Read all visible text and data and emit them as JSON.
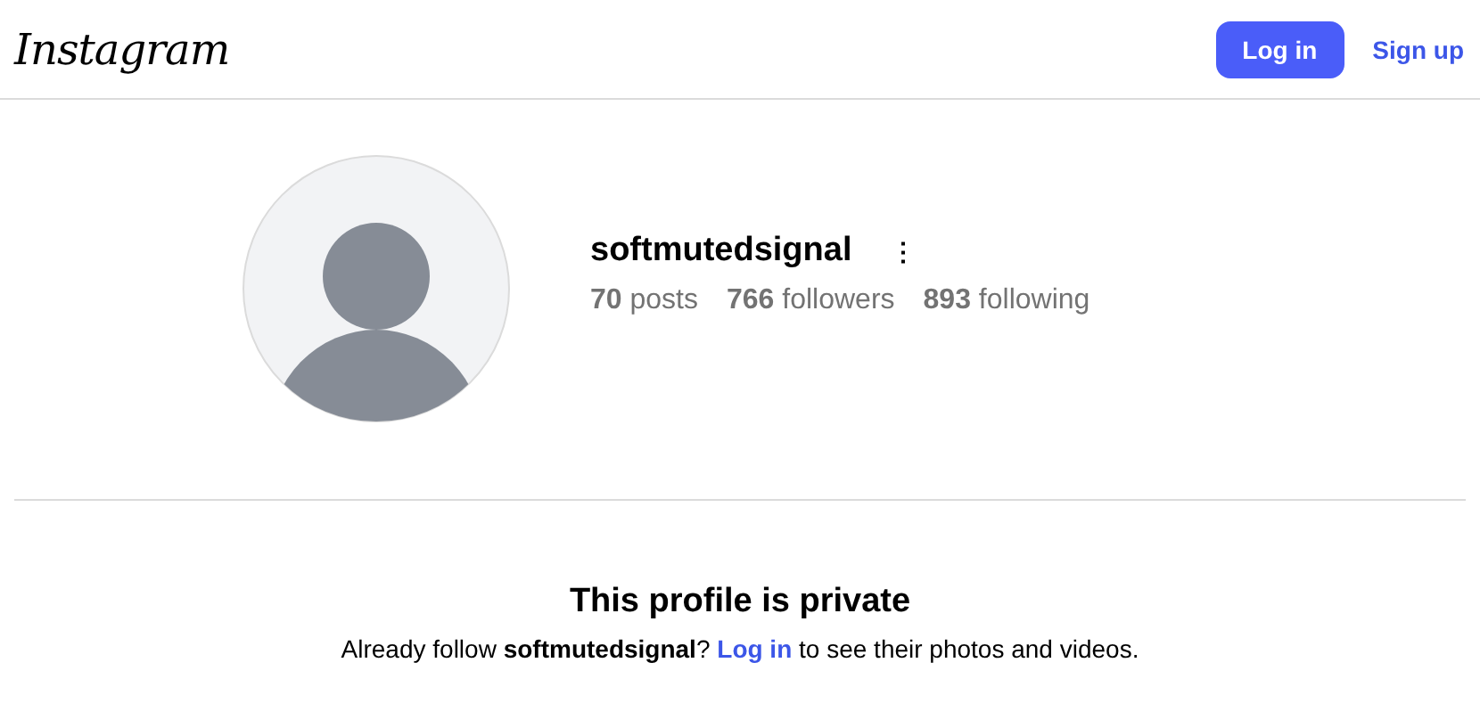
{
  "header": {
    "logo": "Instagram",
    "buttons": [
      {
        "label": "Log in",
        "kind": "primary"
      },
      {
        "label": "Sign up",
        "kind": "link"
      }
    ]
  },
  "profile": {
    "username": "softmutedsignal",
    "more": "⋮",
    "stats": [
      "**70** posts",
      "**766** followers",
      "**893** following"
    ]
  },
  "private": {
    "title": "This profile is private",
    "message_before": "Already follow **softmutedsignal**? ",
    "link": "Log in",
    "message_after": " to see their photos and videos."
  }
}
